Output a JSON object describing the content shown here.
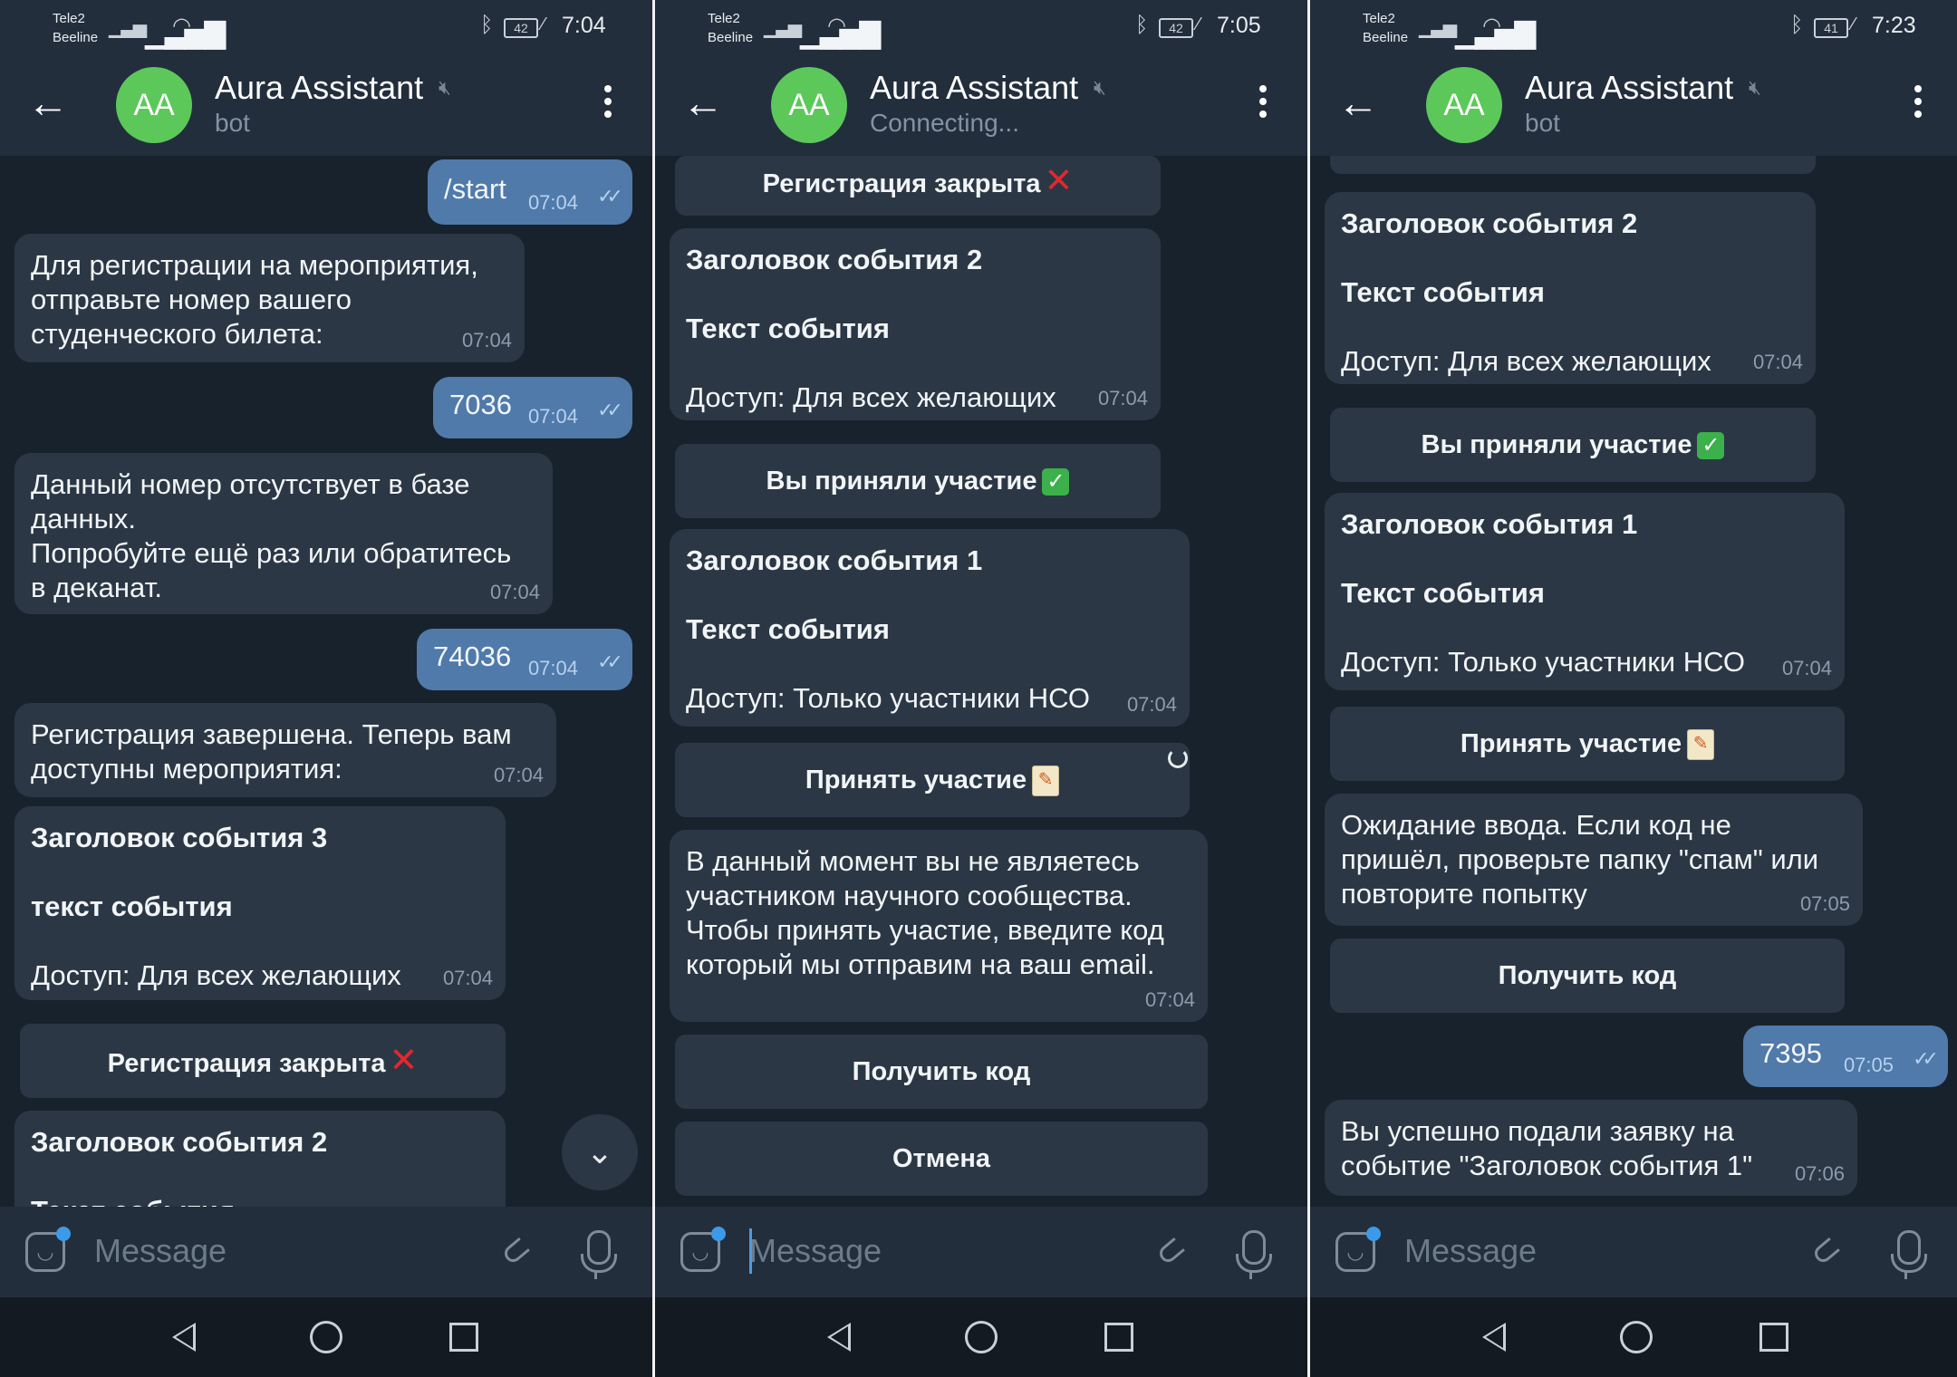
{
  "status": {
    "carrier1": "Tele2",
    "carrier2": "Beeline",
    "screens": [
      {
        "battery": "42",
        "time": "7:04"
      },
      {
        "battery": "42",
        "time": "7:05"
      },
      {
        "battery": "41",
        "time": "7:23"
      }
    ]
  },
  "header": {
    "avatar": "AA",
    "name": "Aura Assistant",
    "subs": [
      "bot",
      "Connecting...",
      "bot"
    ]
  },
  "input": {
    "placeholder": "Message"
  },
  "icons": {
    "back": "arrow-left-icon",
    "menu": "more-vert-icon",
    "mute": "muted-icon",
    "emoji": "sticker-icon",
    "attach": "paperclip-icon",
    "mic": "microphone-icon",
    "scroll": "chevron-down-icon"
  },
  "colors": {
    "avatar": "#5cc85a",
    "outgoing": "#4f7aaa",
    "incoming": "#2b3744",
    "background": "#18222d"
  },
  "screen1": {
    "m1": {
      "text": "/start",
      "time": "07:04"
    },
    "m2": {
      "text": "Для регистрации на мероприятия,\nотправьте номер вашего\nстуденческого билета:",
      "time": "07:04"
    },
    "m3": {
      "text": "7036",
      "time": "07:04"
    },
    "m4": {
      "text": "Данный номер отсутствует в базе\nданных.\nПопробуйте ещё раз или обратитесь\nв деканат.",
      "time": "07:04"
    },
    "m5": {
      "text": "74036",
      "time": "07:04"
    },
    "m6": {
      "text": "Регистрация завершена. Теперь вам\nдоступны мероприятия:",
      "time": "07:04"
    },
    "e3": {
      "title": "Заголовок события 3",
      "body": "текст события",
      "access": "Доступ: Для всех желающих",
      "time": "07:04"
    },
    "btn_closed": "Регистрация закрыта",
    "e2": {
      "title": "Заголовок события 2",
      "body": "Текст события"
    }
  },
  "screen2": {
    "btn_closed": "Регистрация закрыта",
    "e2": {
      "title": "Заголовок события 2",
      "body": "Текст события",
      "access": "Доступ: Для всех желающих",
      "time": "07:04"
    },
    "btn_joined": "Вы приняли участие",
    "e1": {
      "title": "Заголовок события 1",
      "body": "Текст события",
      "access": "Доступ: Только участники НСО",
      "time": "07:04"
    },
    "btn_join": "Принять участие",
    "m_notice": {
      "text": "В данный момент вы не являетесь\nучастником научного сообщества.\nЧтобы принять участие, введите код\nкоторый мы отправим на ваш email.",
      "time": "07:04"
    },
    "btn_code": "Получить код",
    "btn_cancel": "Отмена"
  },
  "screen3": {
    "e2": {
      "title": "Заголовок события 2",
      "body": "Текст события",
      "access": "Доступ: Для всех желающих",
      "time": "07:04"
    },
    "btn_joined": "Вы приняли участие",
    "e1": {
      "title": "Заголовок события 1",
      "body": "Текст события",
      "access": "Доступ: Только участники НСО",
      "time": "07:04"
    },
    "btn_join": "Принять участие",
    "m_wait": {
      "text": "Ожидание ввода. Если код не\nпришёл, проверьте папку \"спам\" или\nповторите попытку",
      "time": "07:05"
    },
    "btn_code": "Получить код",
    "m_code": {
      "text": "7395",
      "time": "07:05"
    },
    "m_done": {
      "text": "Вы успешно подали заявку на\nсобытие \"Заголовок события 1\"",
      "time": "07:06"
    }
  }
}
